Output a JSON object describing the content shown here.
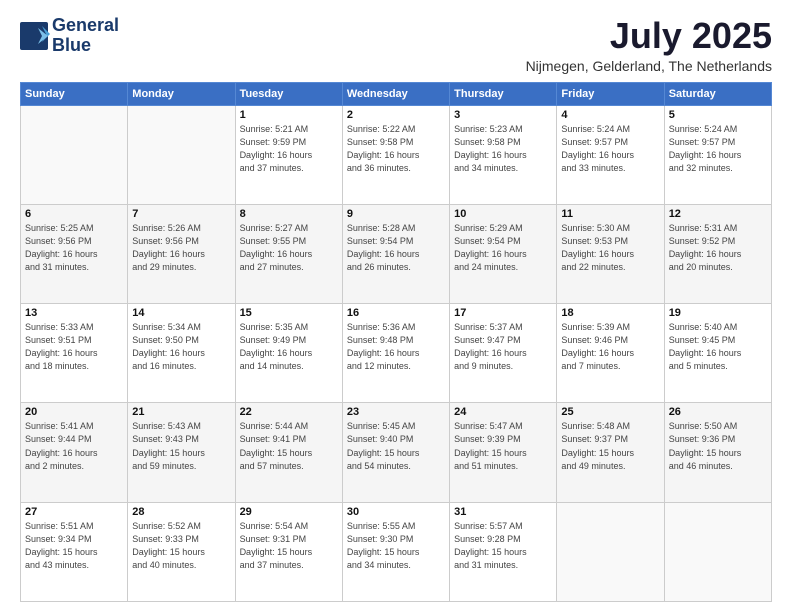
{
  "header": {
    "logo_line1": "General",
    "logo_line2": "Blue",
    "month_title": "July 2025",
    "location": "Nijmegen, Gelderland, The Netherlands"
  },
  "days_of_week": [
    "Sunday",
    "Monday",
    "Tuesday",
    "Wednesday",
    "Thursday",
    "Friday",
    "Saturday"
  ],
  "weeks": [
    [
      {
        "day": "",
        "info": ""
      },
      {
        "day": "",
        "info": ""
      },
      {
        "day": "1",
        "info": "Sunrise: 5:21 AM\nSunset: 9:59 PM\nDaylight: 16 hours\nand 37 minutes."
      },
      {
        "day": "2",
        "info": "Sunrise: 5:22 AM\nSunset: 9:58 PM\nDaylight: 16 hours\nand 36 minutes."
      },
      {
        "day": "3",
        "info": "Sunrise: 5:23 AM\nSunset: 9:58 PM\nDaylight: 16 hours\nand 34 minutes."
      },
      {
        "day": "4",
        "info": "Sunrise: 5:24 AM\nSunset: 9:57 PM\nDaylight: 16 hours\nand 33 minutes."
      },
      {
        "day": "5",
        "info": "Sunrise: 5:24 AM\nSunset: 9:57 PM\nDaylight: 16 hours\nand 32 minutes."
      }
    ],
    [
      {
        "day": "6",
        "info": "Sunrise: 5:25 AM\nSunset: 9:56 PM\nDaylight: 16 hours\nand 31 minutes."
      },
      {
        "day": "7",
        "info": "Sunrise: 5:26 AM\nSunset: 9:56 PM\nDaylight: 16 hours\nand 29 minutes."
      },
      {
        "day": "8",
        "info": "Sunrise: 5:27 AM\nSunset: 9:55 PM\nDaylight: 16 hours\nand 27 minutes."
      },
      {
        "day": "9",
        "info": "Sunrise: 5:28 AM\nSunset: 9:54 PM\nDaylight: 16 hours\nand 26 minutes."
      },
      {
        "day": "10",
        "info": "Sunrise: 5:29 AM\nSunset: 9:54 PM\nDaylight: 16 hours\nand 24 minutes."
      },
      {
        "day": "11",
        "info": "Sunrise: 5:30 AM\nSunset: 9:53 PM\nDaylight: 16 hours\nand 22 minutes."
      },
      {
        "day": "12",
        "info": "Sunrise: 5:31 AM\nSunset: 9:52 PM\nDaylight: 16 hours\nand 20 minutes."
      }
    ],
    [
      {
        "day": "13",
        "info": "Sunrise: 5:33 AM\nSunset: 9:51 PM\nDaylight: 16 hours\nand 18 minutes."
      },
      {
        "day": "14",
        "info": "Sunrise: 5:34 AM\nSunset: 9:50 PM\nDaylight: 16 hours\nand 16 minutes."
      },
      {
        "day": "15",
        "info": "Sunrise: 5:35 AM\nSunset: 9:49 PM\nDaylight: 16 hours\nand 14 minutes."
      },
      {
        "day": "16",
        "info": "Sunrise: 5:36 AM\nSunset: 9:48 PM\nDaylight: 16 hours\nand 12 minutes."
      },
      {
        "day": "17",
        "info": "Sunrise: 5:37 AM\nSunset: 9:47 PM\nDaylight: 16 hours\nand 9 minutes."
      },
      {
        "day": "18",
        "info": "Sunrise: 5:39 AM\nSunset: 9:46 PM\nDaylight: 16 hours\nand 7 minutes."
      },
      {
        "day": "19",
        "info": "Sunrise: 5:40 AM\nSunset: 9:45 PM\nDaylight: 16 hours\nand 5 minutes."
      }
    ],
    [
      {
        "day": "20",
        "info": "Sunrise: 5:41 AM\nSunset: 9:44 PM\nDaylight: 16 hours\nand 2 minutes."
      },
      {
        "day": "21",
        "info": "Sunrise: 5:43 AM\nSunset: 9:43 PM\nDaylight: 15 hours\nand 59 minutes."
      },
      {
        "day": "22",
        "info": "Sunrise: 5:44 AM\nSunset: 9:41 PM\nDaylight: 15 hours\nand 57 minutes."
      },
      {
        "day": "23",
        "info": "Sunrise: 5:45 AM\nSunset: 9:40 PM\nDaylight: 15 hours\nand 54 minutes."
      },
      {
        "day": "24",
        "info": "Sunrise: 5:47 AM\nSunset: 9:39 PM\nDaylight: 15 hours\nand 51 minutes."
      },
      {
        "day": "25",
        "info": "Sunrise: 5:48 AM\nSunset: 9:37 PM\nDaylight: 15 hours\nand 49 minutes."
      },
      {
        "day": "26",
        "info": "Sunrise: 5:50 AM\nSunset: 9:36 PM\nDaylight: 15 hours\nand 46 minutes."
      }
    ],
    [
      {
        "day": "27",
        "info": "Sunrise: 5:51 AM\nSunset: 9:34 PM\nDaylight: 15 hours\nand 43 minutes."
      },
      {
        "day": "28",
        "info": "Sunrise: 5:52 AM\nSunset: 9:33 PM\nDaylight: 15 hours\nand 40 minutes."
      },
      {
        "day": "29",
        "info": "Sunrise: 5:54 AM\nSunset: 9:31 PM\nDaylight: 15 hours\nand 37 minutes."
      },
      {
        "day": "30",
        "info": "Sunrise: 5:55 AM\nSunset: 9:30 PM\nDaylight: 15 hours\nand 34 minutes."
      },
      {
        "day": "31",
        "info": "Sunrise: 5:57 AM\nSunset: 9:28 PM\nDaylight: 15 hours\nand 31 minutes."
      },
      {
        "day": "",
        "info": ""
      },
      {
        "day": "",
        "info": ""
      }
    ]
  ]
}
